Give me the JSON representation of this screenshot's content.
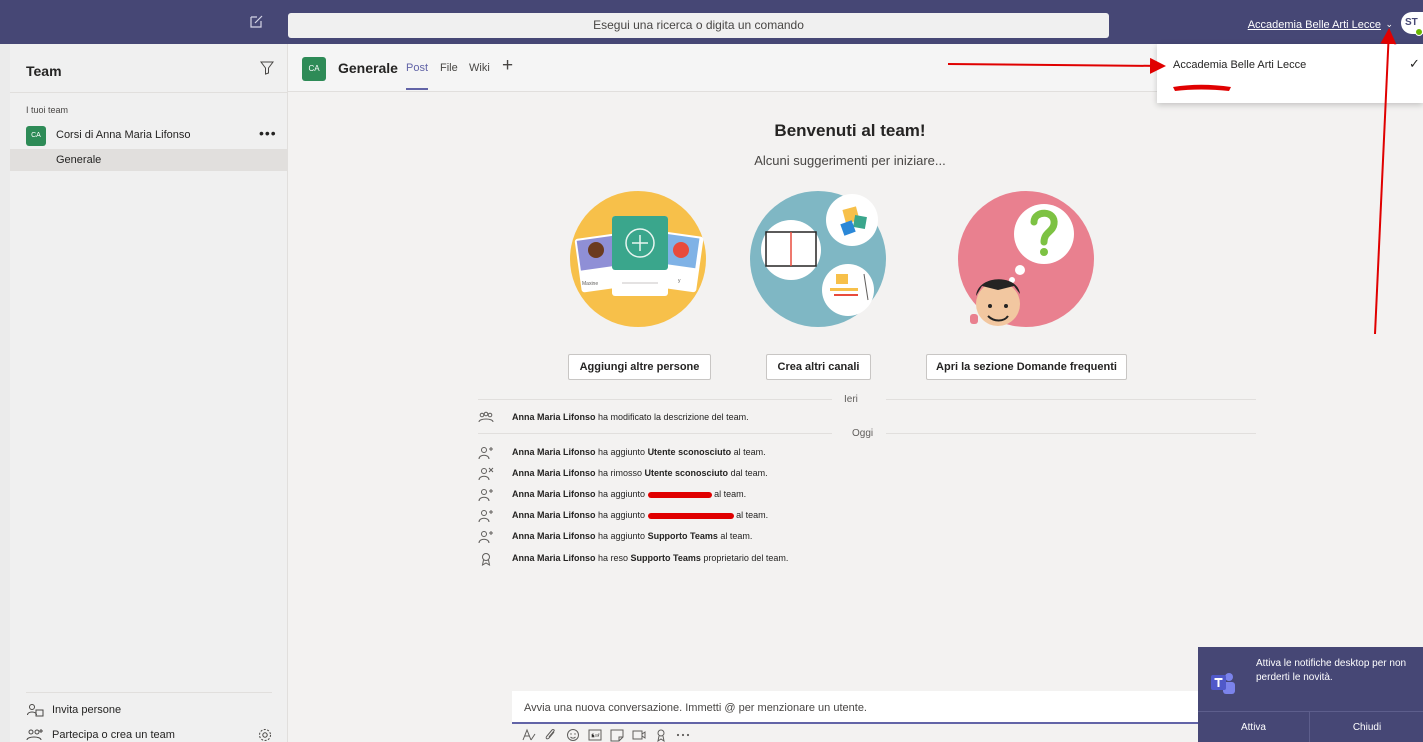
{
  "colors": {
    "brand": "#464775",
    "accent": "#6264a7",
    "team_avatar": "#2e8b57",
    "annotation": "#e00000"
  },
  "topbar": {
    "search_placeholder": "Esegui una ricerca o digita un comando",
    "org_name": "Accademia Belle Arti Lecce",
    "user_initials": "ST"
  },
  "sidebar": {
    "title": "Team",
    "section_label": "I tuoi team",
    "team": {
      "initials": "CA",
      "name": "Corsi di Anna Maria Lifonso",
      "more": "•••"
    },
    "channel": "Generale",
    "bottom": {
      "invite": "Invita persone",
      "join": "Partecipa o crea un team"
    }
  },
  "channel_header": {
    "initials": "CA",
    "title": "Generale",
    "tabs": [
      "Post",
      "File",
      "Wiki"
    ],
    "add_tab": "+"
  },
  "welcome": {
    "title": "Benvenuti al team!",
    "subtitle": "Alcuni suggerimenti per iniziare...",
    "card_names": [
      "Maxine",
      "y"
    ],
    "buttons": [
      "Aggiungi altre persone",
      "Crea altri canali",
      "Apri la sezione Domande frequenti"
    ]
  },
  "activity": {
    "day_ieri": "Ieri",
    "day_oggi": "Oggi",
    "items": [
      {
        "actor": "Anna Maria Lifonso",
        "pre": " ha modificato la descrizione del team.",
        "target": "",
        "post": ""
      },
      {
        "actor": "Anna Maria Lifonso",
        "pre": " ha aggiunto ",
        "target": "Utente sconosciuto",
        "post": " al team."
      },
      {
        "actor": "Anna Maria Lifonso",
        "pre": " ha rimosso ",
        "target": "Utente sconosciuto",
        "post": " dal team."
      },
      {
        "actor": "Anna Maria Lifonso",
        "pre": " ha aggiunto ",
        "target": "",
        "post": " al team."
      },
      {
        "actor": "Anna Maria Lifonso",
        "pre": " ha aggiunto ",
        "target": "",
        "post": " al team."
      },
      {
        "actor": "Anna Maria Lifonso",
        "pre": " ha aggiunto ",
        "target": "Supporto Teams",
        "post": " al team."
      },
      {
        "actor": "Anna Maria Lifonso",
        "pre": " ha reso ",
        "target": "Supporto Teams",
        "post": " proprietario del team."
      }
    ]
  },
  "compose": {
    "placeholder": "Avvia una nuova conversazione. Immetti @ per menzionare un utente."
  },
  "dropdown": {
    "org_name": "Accademia Belle Arti Lecce",
    "check": "✓"
  },
  "toast": {
    "message": "Attiva le notifiche desktop per non perderti le novità.",
    "activate": "Attiva",
    "close": "Chiudi"
  }
}
